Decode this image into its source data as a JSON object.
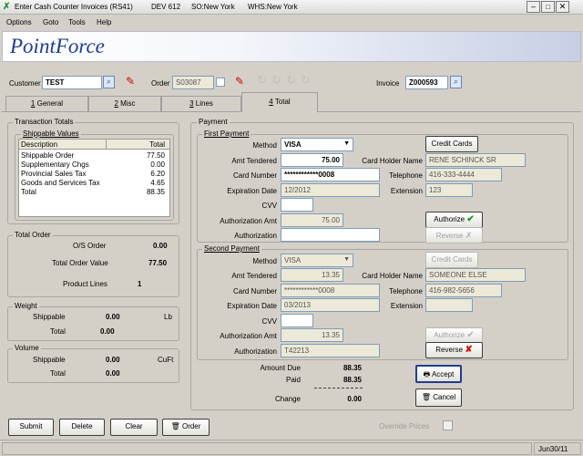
{
  "titlebar": {
    "app": "Enter Cash Counter Invoices (RS41)",
    "dev": "DEV 612",
    "so": "SO:New York",
    "whs": "WHS:New York"
  },
  "menu": [
    "Options",
    "Goto",
    "Tools",
    "Help"
  ],
  "brand": "PointForce",
  "header": {
    "customer_label": "Customer",
    "customer_value": "TEST",
    "order_label": "Order",
    "order_value": "S03087",
    "invoice_label": "Invoice",
    "invoice_value": "Z000593"
  },
  "tabs": [
    {
      "num": "1",
      "label": " General"
    },
    {
      "num": "2",
      "label": " Misc"
    },
    {
      "num": "3",
      "label": " Lines"
    },
    {
      "num": "4",
      "label": " Total"
    }
  ],
  "left": {
    "transaction_totals": "Transaction Totals",
    "shippable_values": "Shippable Values",
    "table_headers": [
      "Description",
      "Total"
    ],
    "table_rows": [
      {
        "desc": "Shippable Order",
        "total": "77.50"
      },
      {
        "desc": "Supplementary Chgs",
        "total": "0.00"
      },
      {
        "desc": "Provincial Sales Tax",
        "total": "6.20"
      },
      {
        "desc": "Goods and Services Tax",
        "total": "4.65"
      },
      {
        "desc": "Total",
        "total": "88.35"
      }
    ],
    "total_order_title": "Total Order",
    "os_order_label": "O/S Order",
    "os_order_value": "0.00",
    "total_order_value_label": "Total Order Value",
    "total_order_value": "77.50",
    "product_lines_label": "Product Lines",
    "product_lines_value": "1",
    "weight_title": "Weight",
    "weight_shippable_label": "Shippable",
    "weight_shippable_value": "0.00",
    "weight_unit": "Lb",
    "weight_total_label": "Total",
    "weight_total_value": "0.00",
    "volume_title": "Volume",
    "volume_shippable_label": "Shippable",
    "volume_shippable_value": "0.00",
    "volume_unit": "CuFt",
    "volume_total_label": "Total",
    "volume_total_value": "0.00"
  },
  "payment": {
    "title": "Payment",
    "first": {
      "title": "First Payment",
      "method_label": "Method",
      "method": "VISA",
      "amt_tendered_label": "Amt Tendered",
      "amt_tendered": "75.00",
      "card_holder_label": "Card Holder Name",
      "card_holder": "RENE SCHINCK SR",
      "card_number_label": "Card Number",
      "card_number": "************0008",
      "telephone_label": "Telephone",
      "telephone": "416-333-4444",
      "exp_label": "Expiration Date",
      "exp": "12/2012",
      "ext_label": "Extension",
      "ext": "123",
      "cvv_label": "CVV",
      "cvv": "",
      "auth_amt_label": "Authorization Amt",
      "auth_amt": "75.00",
      "auth_label": "Authorization",
      "auth": "",
      "credit_cards_btn": "Credit Cards",
      "authorize_btn": "Authorize",
      "reverse_btn": "Reverse"
    },
    "second": {
      "title": "Second Payment",
      "method_label": "Method",
      "method": "VISA",
      "amt_tendered_label": "Amt Tendered",
      "amt_tendered": "13.35",
      "card_holder_label": "Card Holder Name",
      "card_holder": "SOMEONE ELSE",
      "card_number_label": "Card Number",
      "card_number": "************0008",
      "telephone_label": "Telephone",
      "telephone": "416-982-5656",
      "exp_label": "Expiration Date",
      "exp": "03/2013",
      "ext_label": "Extension",
      "ext": "",
      "cvv_label": "CVV",
      "cvv": "",
      "auth_amt_label": "Authorization Amt",
      "auth_amt": "13.35",
      "auth_label": "Authorization",
      "auth": "T42213",
      "credit_cards_btn": "Credit Cards",
      "authorize_btn": "Authorize",
      "reverse_btn": "Reverse"
    },
    "amount_due_label": "Amount Due",
    "amount_due": "88.35",
    "paid_label": "Paid",
    "paid": "88.35",
    "change_label": "Change",
    "change": "0.00",
    "accept_btn": "Accept",
    "cancel_btn": "Cancel"
  },
  "bottom": {
    "submit": "Submit",
    "delete": "Delete",
    "clear": "Clear",
    "order": "Order",
    "override_prices": "Override Prices"
  },
  "status": {
    "date": "Jun30/11"
  },
  "colors": {
    "titlebar": "#0a246a",
    "brand_blue": "#1f3d8f",
    "green_check": "#1a9a1a",
    "red_x": "#c81414"
  }
}
